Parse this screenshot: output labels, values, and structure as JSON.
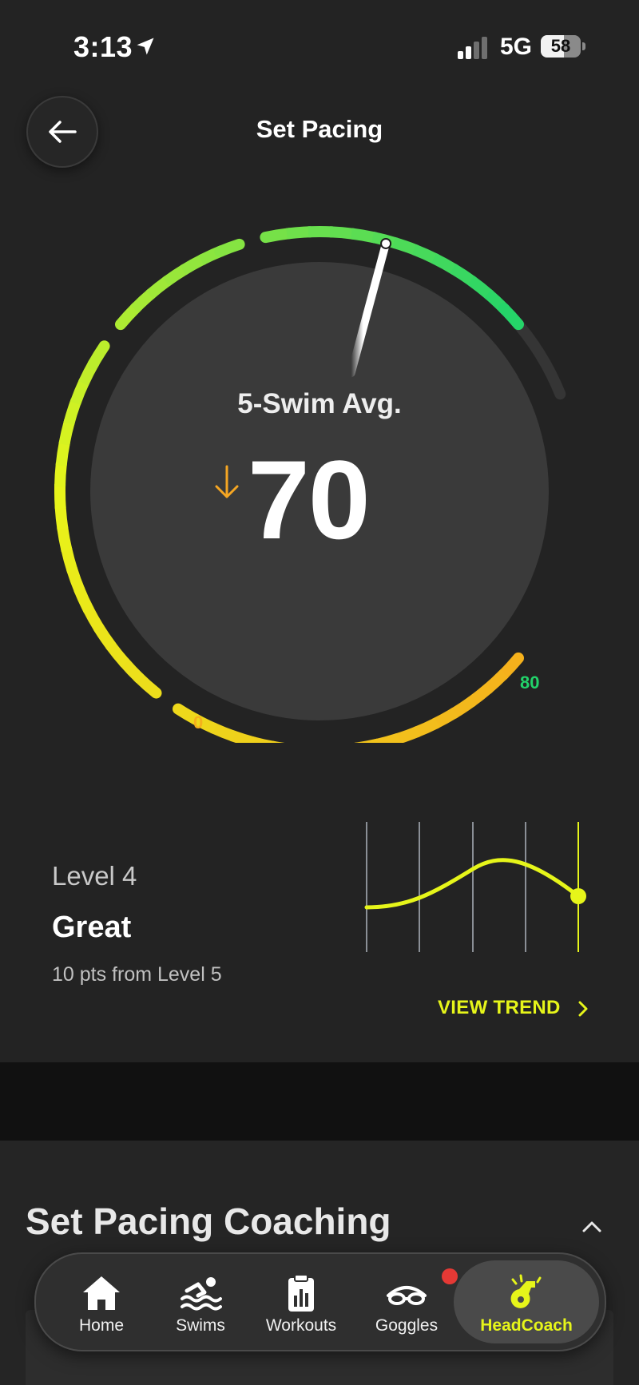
{
  "status_bar": {
    "time": "3:13",
    "network": "5G",
    "battery": "58",
    "battery_level": 0.58
  },
  "header": {
    "title": "Set Pacing"
  },
  "gauge": {
    "caption": "5-Swim Avg.",
    "value": "70",
    "value_numeric": 70,
    "scale_min": "0",
    "scale_max": "80",
    "trend_direction": "down",
    "colors": {
      "low": "#f5b01c",
      "mid": "#e8f51a",
      "high": "#22d36a",
      "needle": "#ffffff"
    }
  },
  "level": {
    "label": "Level 4",
    "rating": "Great",
    "hint": "10 pts from Level 5",
    "view_trend_label": "VIEW TREND",
    "trend_color": "#e6f51a"
  },
  "coaching": {
    "title": "Set Pacing Coaching"
  },
  "tab_bar": {
    "items": [
      {
        "label": "Home",
        "icon": "home-icon"
      },
      {
        "label": "Swims",
        "icon": "swimmer-icon"
      },
      {
        "label": "Workouts",
        "icon": "clipboard-icon"
      },
      {
        "label": "Goggles",
        "icon": "goggles-icon"
      },
      {
        "label": "HeadCoach",
        "icon": "whistle-icon"
      }
    ],
    "active": "HeadCoach",
    "accent": "#e6f51a"
  }
}
